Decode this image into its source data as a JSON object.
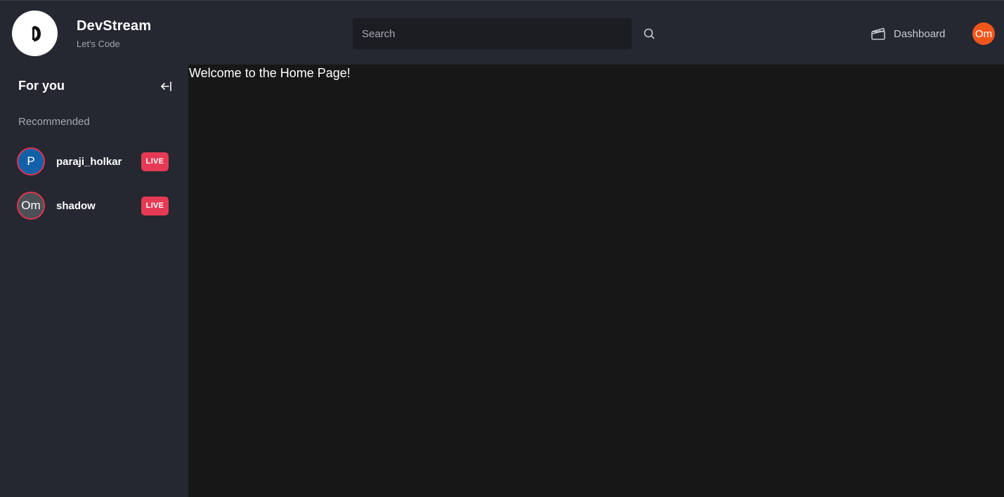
{
  "header": {
    "brand_name": "DevStream",
    "brand_tagline": "Let's Code",
    "search_placeholder": "Search",
    "dashboard_label": "Dashboard",
    "user_initials": "Om",
    "user_avatar_color": "#f0561c"
  },
  "sidebar": {
    "title": "For you",
    "section_label": "Recommended",
    "users": [
      {
        "initials": "P",
        "name": "paraji_holkar",
        "badge": "LIVE",
        "avatar_color": "#1261a8"
      },
      {
        "initials": "Om",
        "name": "shadow",
        "badge": "LIVE",
        "avatar_color": "#4b5157"
      }
    ]
  },
  "main": {
    "welcome_text": "Welcome to the Home Page!"
  },
  "colors": {
    "header_bg": "#252731",
    "main_bg": "#171717",
    "live_badge": "#e53a55"
  }
}
